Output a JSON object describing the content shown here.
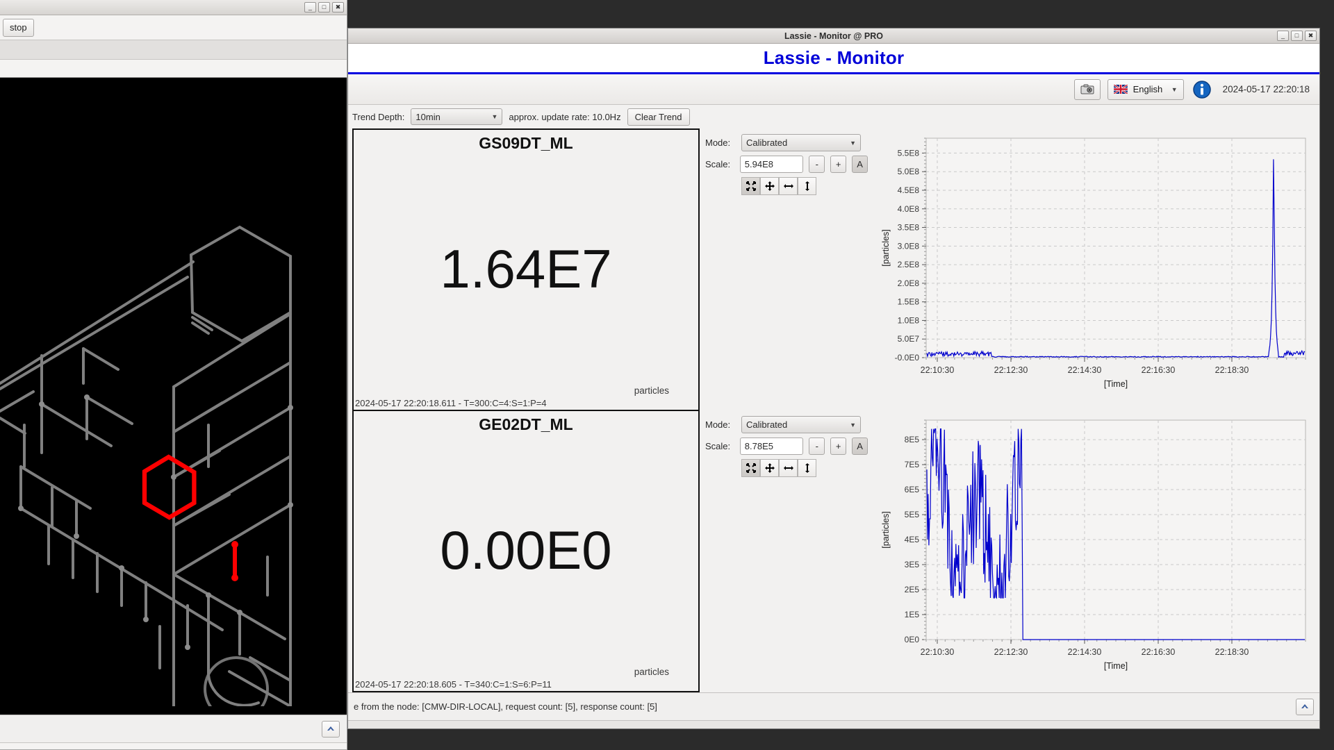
{
  "left_window": {
    "title": "",
    "stop_button": "stop",
    "window_controls": [
      "minimize",
      "maximize",
      "close"
    ],
    "canvas_name": "3d-beamline-view",
    "highlight_color": "#ff0000",
    "wire_color": "#808080",
    "background": "#000000",
    "collapse_label": "▲"
  },
  "lassie": {
    "window_title": "Lassie - Monitor @ PRO",
    "banner_title": "Lassie - Monitor",
    "banner_underline_color": "#0000e0",
    "window_controls": [
      "minimize",
      "maximize",
      "close"
    ],
    "toolbar": {
      "screenshot_icon": "camera-icon",
      "language": "English",
      "language_flag": "uk-flag-icon",
      "info_icon": "info-icon",
      "timestamp": "2024-05-17 22:20:18",
      "caret": "▼"
    },
    "trendbar": {
      "depth_label": "Trend Depth:",
      "depth_value": "10min",
      "update_rate_label": "approx. update rate:  10.0Hz",
      "clear_button": "Clear Trend",
      "caret": "▼"
    },
    "panels": [
      {
        "device": "GS09DT_ML",
        "value": "1.64E7",
        "unit": "particles",
        "status": "2024-05-17 22:20:18.611 - T=300:C=4:S=1:P=4",
        "mode_label": "Mode:",
        "mode_value": "Calibrated",
        "scale_label": "Scale:",
        "scale_value": "5.94E8",
        "minus": "-",
        "plus": "+",
        "auto": "A",
        "icons": [
          "fit-all-icon",
          "pan-icon",
          "fit-horizontal-icon",
          "fit-vertical-icon"
        ]
      },
      {
        "device": "GE02DT_ML",
        "value": "0.00E0",
        "unit": "particles",
        "status": "2024-05-17 22:20:18.605 - T=340:C=1:S=6:P=11",
        "mode_label": "Mode:",
        "mode_value": "Calibrated",
        "scale_label": "Scale:",
        "scale_value": "8.78E5",
        "minus": "-",
        "plus": "+",
        "auto": "A",
        "icons": [
          "fit-all-icon",
          "pan-icon",
          "fit-horizontal-icon",
          "fit-vertical-icon"
        ]
      }
    ],
    "statusbar": {
      "text": "e from the node: [CMW-DIR-LOCAL], request count: [5], response count: [5]",
      "collapse_label": "▲"
    }
  },
  "chart_data": [
    {
      "type": "line",
      "name": "GS09DT_ML trend",
      "title": "",
      "xlabel": "[Time]",
      "ylabel": "[particles]",
      "series_color": "#0000cc",
      "grid": true,
      "ylim": [
        0,
        590000000
      ],
      "ytick_labels": [
        "-0.0E0",
        "5.0E7",
        "1.0E8",
        "1.5E8",
        "2.0E8",
        "2.5E8",
        "3.0E8",
        "3.5E8",
        "4.0E8",
        "4.5E8",
        "5.0E8",
        "5.5E8"
      ],
      "ytick_values": [
        0,
        50000000,
        100000000,
        150000000,
        200000000,
        250000000,
        300000000,
        350000000,
        400000000,
        450000000,
        500000000,
        550000000
      ],
      "xtick_labels": [
        "22:10:30",
        "22:12:30",
        "22:14:30",
        "22:16:30",
        "22:18:30"
      ],
      "description": "flat noise near zero across the window with a single tall narrow spike reaching about 5.8E8 near 22:18:40",
      "points": [
        {
          "t": "22:10:20",
          "v": 6000000
        },
        {
          "t": "22:11:10",
          "v": 7000000
        },
        {
          "t": "22:11:55",
          "v": 5000000
        },
        {
          "t": "22:12:20",
          "v": 1500000
        },
        {
          "t": "22:13:30",
          "v": 1500000
        },
        {
          "t": "22:15:00",
          "v": 1500000
        },
        {
          "t": "22:16:30",
          "v": 1500000
        },
        {
          "t": "22:18:00",
          "v": 1500000
        },
        {
          "t": "22:18:38",
          "v": 580000000
        },
        {
          "t": "22:18:45",
          "v": 2000000
        },
        {
          "t": "22:19:10",
          "v": 8000000
        },
        {
          "t": "22:19:50",
          "v": 9000000
        }
      ]
    },
    {
      "type": "line",
      "name": "GE02DT_ML trend",
      "title": "",
      "xlabel": "[Time]",
      "ylabel": "[particles]",
      "series_color": "#0000cc",
      "grid": true,
      "ylim": [
        0,
        878000
      ],
      "ytick_labels": [
        "0E0",
        "1E5",
        "2E5",
        "3E5",
        "4E5",
        "5E5",
        "6E5",
        "7E5",
        "8E5"
      ],
      "ytick_values": [
        0,
        100000,
        200000,
        300000,
        400000,
        500000,
        600000,
        700000,
        800000
      ],
      "xtick_labels": [
        "22:10:30",
        "22:12:30",
        "22:14:30",
        "22:16:30",
        "22:18:30"
      ],
      "description": "dense high-frequency oscillation between about 1.7E5 and 8.3E5 from 22:10:20 until about 22:13:05, then flat at zero for the remainder",
      "noise_band": {
        "start": "22:10:20",
        "end": "22:13:05",
        "min": 170000,
        "max": 835000,
        "mean": 520000
      },
      "flat_after": {
        "start": "22:13:05",
        "value": 0
      }
    }
  ]
}
